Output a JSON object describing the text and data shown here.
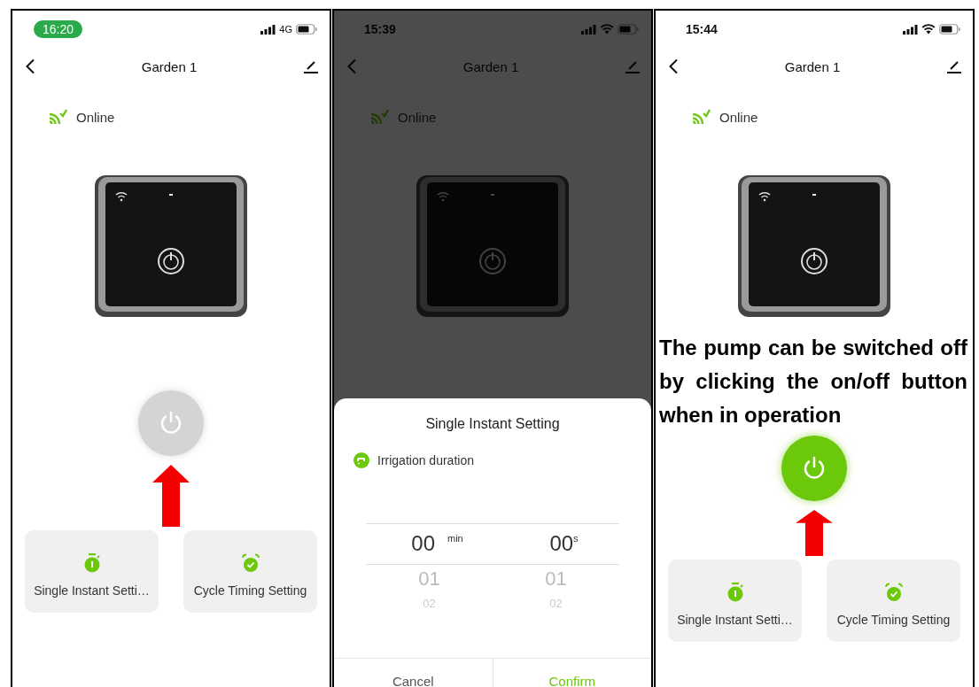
{
  "screens": [
    {
      "status_bar": {
        "time": "16:20",
        "time_highlighted": true,
        "network": {
          "kind": "cellular",
          "label": "4G"
        }
      },
      "header": {
        "title": "Garden 1"
      },
      "connection": {
        "label": "Online"
      },
      "power_button": {
        "on": false
      },
      "pointer_arrow": true,
      "tiles": [
        {
          "kind": "stopwatch",
          "label": "Single Instant Setti…"
        },
        {
          "kind": "alarm",
          "label": "Cycle Timing Setting"
        }
      ]
    },
    {
      "status_bar": {
        "time": "15:39",
        "time_highlighted": false,
        "network": {
          "kind": "wifi"
        }
      },
      "header": {
        "title": "Garden 1"
      },
      "connection": {
        "label": "Online"
      },
      "dimmed": true,
      "sheet": {
        "title": "Single Instant Setting",
        "field_label": "Irrigation duration",
        "picker": [
          {
            "unit": "min",
            "items": [
              {
                "value": "00",
                "selected": true
              },
              {
                "value": "01",
                "selected": false
              },
              {
                "value": "02",
                "selected": false
              }
            ]
          },
          {
            "unit": "s",
            "items": [
              {
                "value": "00",
                "selected": true
              },
              {
                "value": "01",
                "selected": false
              },
              {
                "value": "02",
                "selected": false
              }
            ]
          }
        ],
        "buttons": [
          {
            "kind": "cancel",
            "label": "Cancel"
          },
          {
            "kind": "confirm",
            "label": "Confirm"
          }
        ]
      }
    },
    {
      "status_bar": {
        "time": "15:44",
        "time_highlighted": false,
        "network": {
          "kind": "wifi"
        }
      },
      "header": {
        "title": "Garden 1"
      },
      "connection": {
        "label": "Online"
      },
      "annotation": "The pump can be switched off by clicking the on/off button when in operation",
      "power_button": {
        "on": true
      },
      "pointer_arrow": true,
      "tiles": [
        {
          "kind": "stopwatch",
          "label": "Single Instant Setti…"
        },
        {
          "kind": "alarm",
          "label": "Cycle Timing Setting"
        }
      ]
    }
  ]
}
